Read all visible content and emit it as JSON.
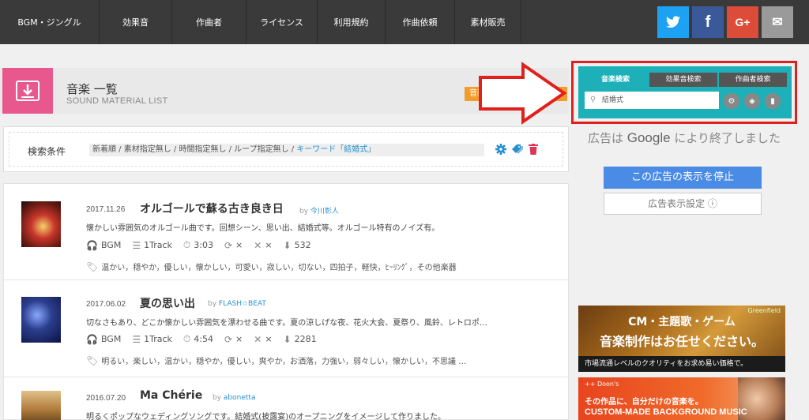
{
  "nav": {
    "items": [
      "BGM・ジングル",
      "効果音",
      "作曲者",
      "ライセンス",
      "利用規約",
      "作曲依頼",
      "素材販売"
    ],
    "social": [
      {
        "name": "twitter-icon",
        "glyph": "🐦",
        "color": "#1da1f2"
      },
      {
        "name": "facebook-icon",
        "glyph": "f",
        "color": "#3b5998"
      },
      {
        "name": "googleplus-icon",
        "glyph": "G+",
        "color": "#dd4b39"
      },
      {
        "name": "mail-icon",
        "glyph": "✉",
        "color": "#9a9a9a"
      }
    ]
  },
  "header": {
    "title": "音楽 一覧",
    "subtitle": "SOUND MATERIAL LIST",
    "orange_tag": "音楽"
  },
  "search_conditions": {
    "label": "検索条件",
    "chips": "新着順 / 素材指定無し / 時間指定無し / ループ指定無し / ",
    "keyword": "キーワード「結婚式」"
  },
  "tracks": [
    {
      "date": "2017.11.26",
      "title": "オルゴールで蘇る古き良き日",
      "by": "by",
      "author": "今川彰人",
      "description": "懐かしい雰囲気のオルゴール曲です。回想シーン、思い出、結婚式等。オルゴール特有のノイズ有。",
      "type": "BGM",
      "tracks": "1Track",
      "duration": "3:03",
      "loop": "×",
      "tool": "×",
      "downloads": "532",
      "tags": "温かい，穏やか，優しい，懐かしい，可愛い，寂しい，切ない，四拍子，軽快，ﾋｰﾘﾝｸﾞ，その他楽器"
    },
    {
      "date": "2017.06.02",
      "title": "夏の思い出",
      "by": "by",
      "author": "FLASH☆BEAT",
      "description": "切なさもあり、どこか懐かしい雰囲気を漂わせる曲です。夏の涼しげな夜、花火大会、夏祭り、風鈴、レトロポ…",
      "type": "BGM",
      "tracks": "1Track",
      "duration": "4:54",
      "loop": "×",
      "tool": "×",
      "downloads": "2281",
      "tags": "明るい，楽しい，温かい，穏やか，優しい，爽やか，お洒落，力強い，弱々しい，懐かしい，不思議 …"
    },
    {
      "date": "2016.07.20",
      "title": "Ma Chérie",
      "by": "by",
      "author": "abonetta",
      "description": "明るくポップなウェディングソングです。結婚式(披露宴)のオープニングをイメージして作りました。"
    }
  ],
  "search_panel": {
    "tabs": [
      "音楽検索",
      "効果音検索",
      "作曲者検索"
    ],
    "input_value": "結婚式"
  },
  "ad": {
    "ended_text_1": "広告は",
    "google": "Google",
    "ended_text_2": "により終了しました",
    "stop_button": "この広告の表示を停止",
    "settings_button": "広告表示設定 ⓘ"
  },
  "banner1": {
    "line1": "CM・主題歌・ゲーム",
    "line2": "音楽制作はお任せください。",
    "line3": "市場流通レベルのクオリティをお求め易い価格で。",
    "logo": "Greenfield"
  },
  "banner2": {
    "logo": "++ Doon's",
    "line1": "その作品に、自分だけの音楽を。",
    "line2": "CUSTOM-MADE BACKGROUND MUSIC"
  }
}
